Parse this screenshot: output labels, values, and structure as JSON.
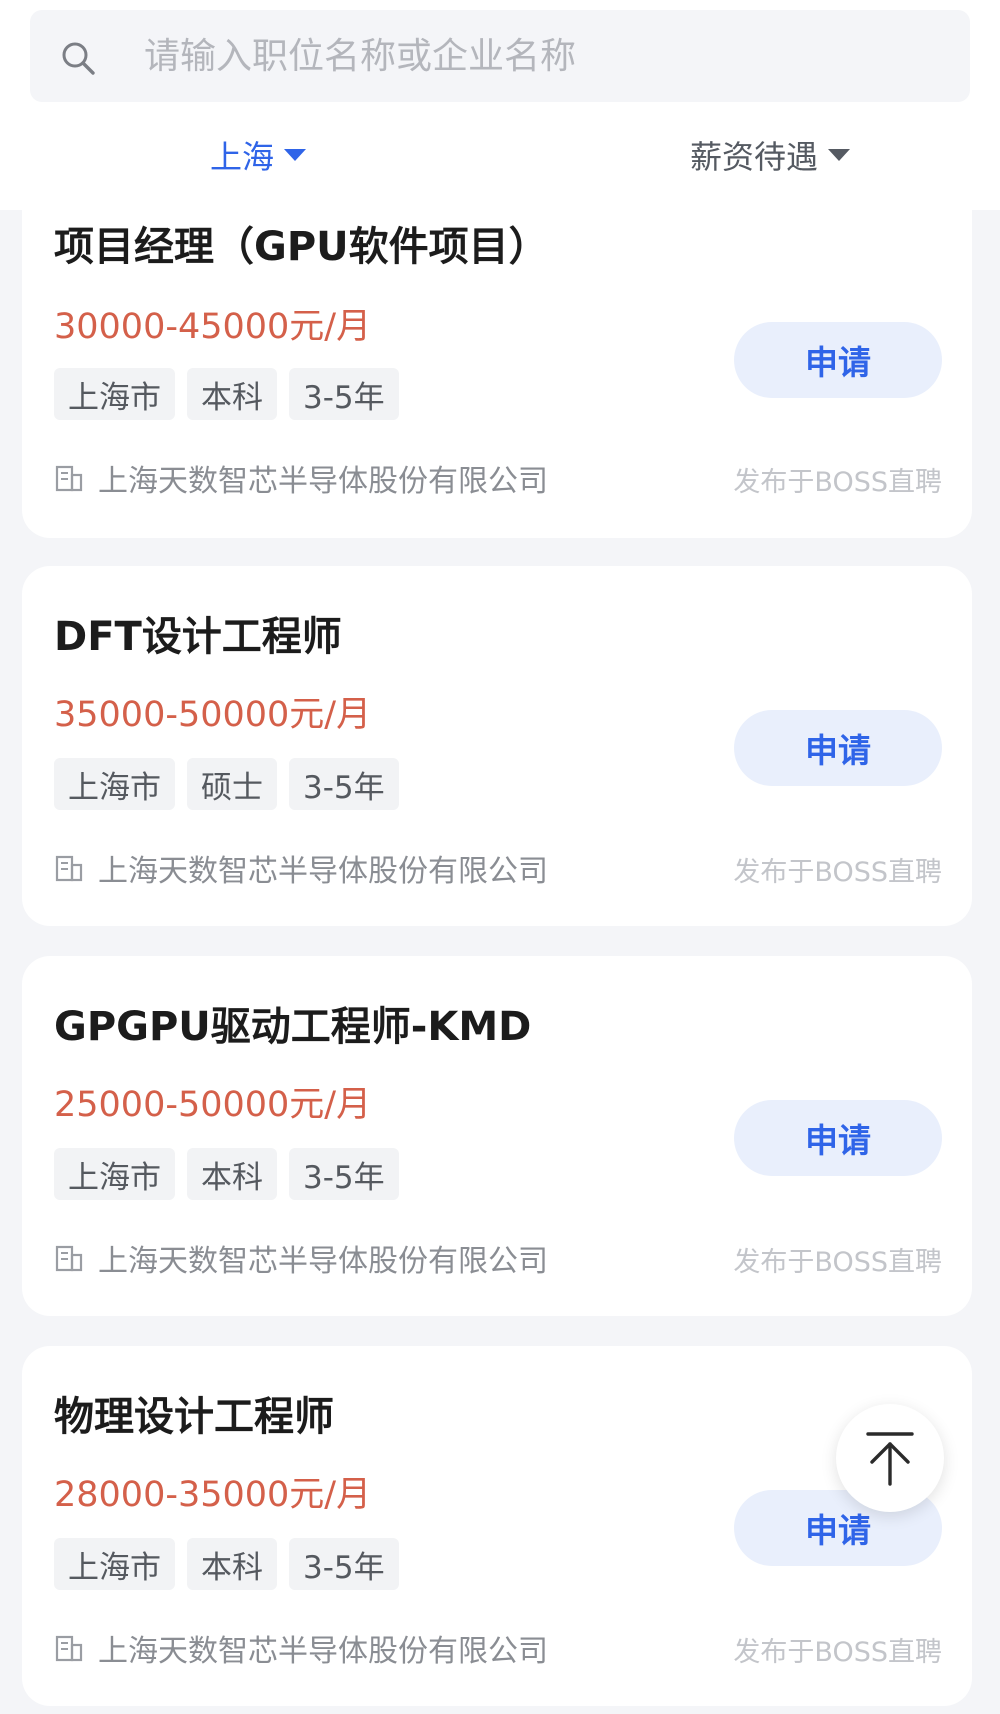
{
  "search": {
    "placeholder": "请输入职位名称或企业名称"
  },
  "filters": {
    "city": "上海",
    "salary": "薪资待遇"
  },
  "jobs": [
    {
      "title": "项目经理（GPU软件项目）",
      "salary": "30000-45000元/月",
      "tags": [
        "上海市",
        "本科",
        "3-5年"
      ],
      "company": "上海天数智芯半导体股份有限公司",
      "source": "发布于BOSS直聘",
      "apply_label": "申请"
    },
    {
      "title": "DFT设计工程师",
      "salary": "35000-50000元/月",
      "tags": [
        "上海市",
        "硕士",
        "3-5年"
      ],
      "company": "上海天数智芯半导体股份有限公司",
      "source": "发布于BOSS直聘",
      "apply_label": "申请"
    },
    {
      "title": "GPGPU驱动工程师-KMD",
      "salary": "25000-50000元/月",
      "tags": [
        "上海市",
        "本科",
        "3-5年"
      ],
      "company": "上海天数智芯半导体股份有限公司",
      "source": "发布于BOSS直聘",
      "apply_label": "申请"
    },
    {
      "title": "物理设计工程师",
      "salary": "28000-35000元/月",
      "tags": [
        "上海市",
        "本科",
        "3-5年"
      ],
      "company": "上海天数智芯半导体股份有限公司",
      "source": "发布于BOSS直聘",
      "apply_label": "申请"
    }
  ],
  "icons": {
    "search": "search-icon",
    "building": "building-icon",
    "back_to_top": "arrow-up-icon"
  },
  "colors": {
    "accent": "#2f64e8",
    "salary": "#d4604a",
    "apply_bg": "#e9effc"
  }
}
